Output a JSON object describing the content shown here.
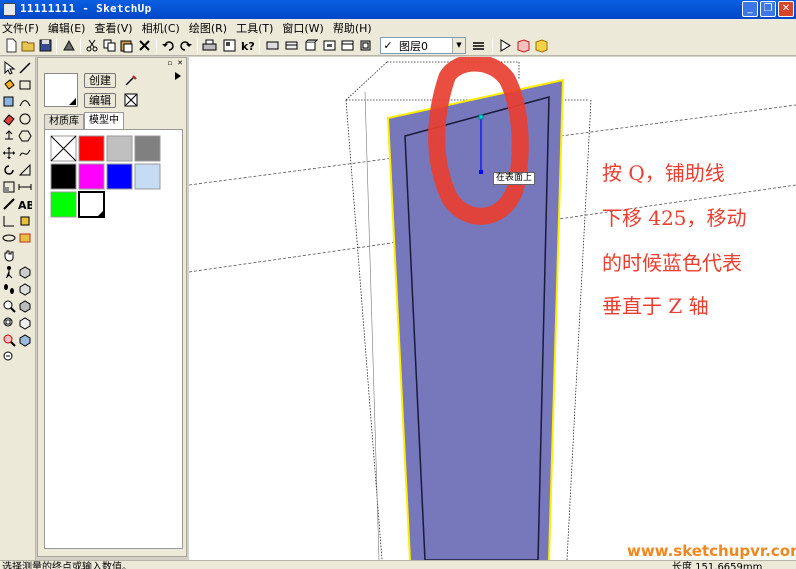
{
  "window": {
    "title": "11111111 - SketchUp"
  },
  "menu": [
    "文件(F)",
    "编辑(E)",
    "查看(V)",
    "相机(C)",
    "绘图(R)",
    "工具(T)",
    "窗口(W)",
    "帮助(H)"
  ],
  "toolbar": {
    "layer_value": "图层0"
  },
  "material_panel": {
    "create_label": "创建",
    "edit_label": "编辑",
    "tabs": [
      "材质库",
      "模型中"
    ],
    "active_tab": "模型中",
    "swatches": [
      "#ffffff",
      "#ff0000",
      "#c0c0c0",
      "#808080",
      "#000000",
      "#ff00ff",
      "#0000ff",
      "#c6dcf5",
      "#00ff00",
      "#ffffff"
    ]
  },
  "viewport": {
    "tooltip": "在表面上",
    "note_lines": [
      "按 Q，铺助线",
      "下移 425，移动",
      "的时候蓝色代表",
      "垂直于 Z 轴"
    ],
    "watermark": "www.sketchupvr.com",
    "colors": {
      "face": "#7777bb",
      "edge_highlight": "#ffee00",
      "guide": "#0000ff",
      "annotation": "#e83f30"
    }
  },
  "status": {
    "text": "选择测量的终点或输入数值。",
    "length": "长度 151.6659mm"
  }
}
